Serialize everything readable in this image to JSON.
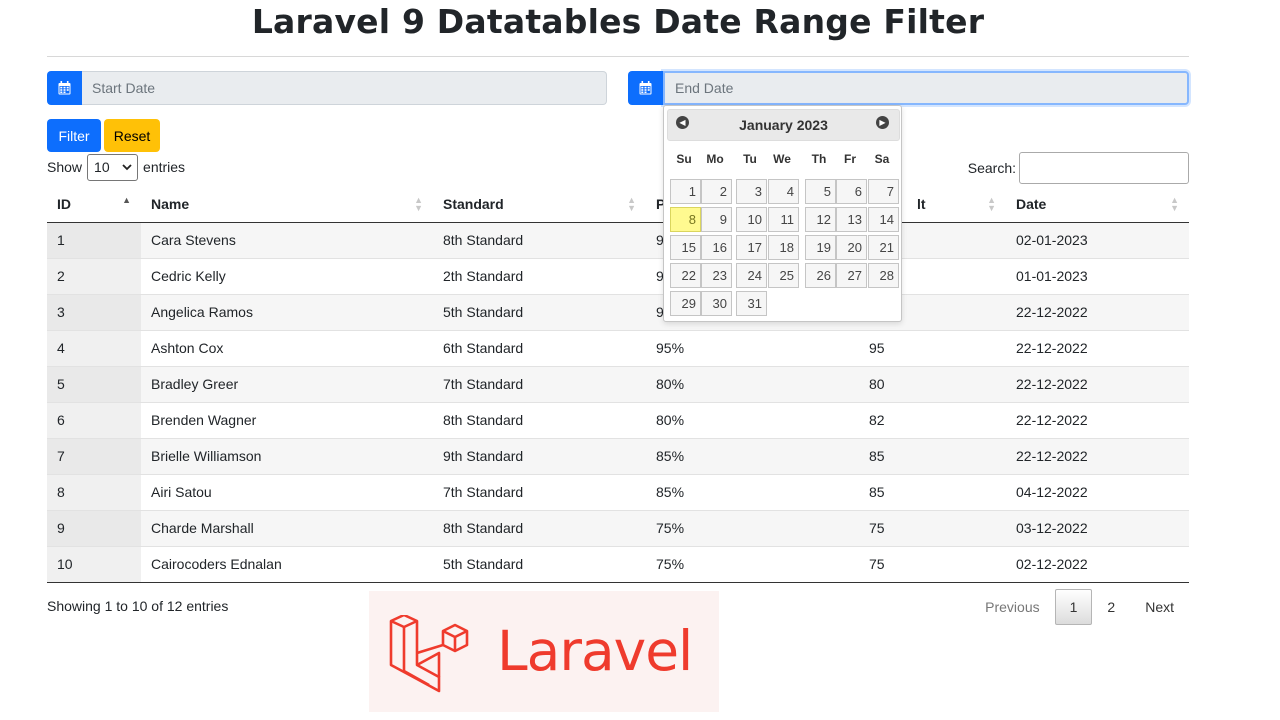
{
  "page": {
    "title": "Laravel 9 Datatables Date Range Filter"
  },
  "filters": {
    "start_placeholder": "Start Date",
    "end_placeholder": "End Date",
    "filter_label": "Filter",
    "reset_label": "Reset"
  },
  "length": {
    "show_label": "Show",
    "value": "10",
    "entries_label": "entries"
  },
  "search": {
    "label": "Search:",
    "value": ""
  },
  "table": {
    "columns": [
      "ID",
      "Name",
      "Standard",
      "P",
      "lt",
      "Date"
    ],
    "sorted_column": "ID",
    "sort_direction": "asc",
    "rows": [
      [
        "1",
        "Cara Stevens",
        "8th Standard",
        "9",
        "",
        "02-01-2023"
      ],
      [
        "2",
        "Cedric Kelly",
        "2th Standard",
        "9",
        "",
        "01-01-2023"
      ],
      [
        "3",
        "Angelica Ramos",
        "5th Standard",
        "9",
        "",
        "22-12-2022"
      ],
      [
        "4",
        "Ashton Cox",
        "6th Standard",
        "95%",
        "95",
        "22-12-2022"
      ],
      [
        "5",
        "Bradley Greer",
        "7th Standard",
        "80%",
        "80",
        "22-12-2022"
      ],
      [
        "6",
        "Brenden Wagner",
        "8th Standard",
        "80%",
        "82",
        "22-12-2022"
      ],
      [
        "7",
        "Brielle Williamson",
        "9th Standard",
        "85%",
        "85",
        "22-12-2022"
      ],
      [
        "8",
        "Airi Satou",
        "7th Standard",
        "85%",
        "85",
        "04-12-2022"
      ],
      [
        "9",
        "Charde Marshall",
        "8th Standard",
        "75%",
        "75",
        "03-12-2022"
      ],
      [
        "10",
        "Cairocoders Ednalan",
        "5th Standard",
        "75%",
        "75",
        "02-12-2022"
      ]
    ]
  },
  "info": "Showing 1 to 10 of 12 entries",
  "pagination": {
    "previous": "Previous",
    "pages": [
      "1",
      "2"
    ],
    "current": "1",
    "next": "Next"
  },
  "datepicker": {
    "month_label": "January 2023",
    "weekdays": [
      "Su",
      "Mo",
      "Tu",
      "We",
      "Th",
      "Fr",
      "Sa"
    ],
    "first_weekday_index": 0,
    "days_in_month": 31,
    "today": 8
  },
  "logo": {
    "text": "Laravel",
    "color": "#ef3b2d"
  },
  "colors": {
    "primary": "#0d6efd",
    "warning": "#ffc107",
    "today_highlight": "#fffa90"
  },
  "icons": {
    "date_button": "calendar-icon",
    "logo_mark": "laravel-logo-icon"
  }
}
